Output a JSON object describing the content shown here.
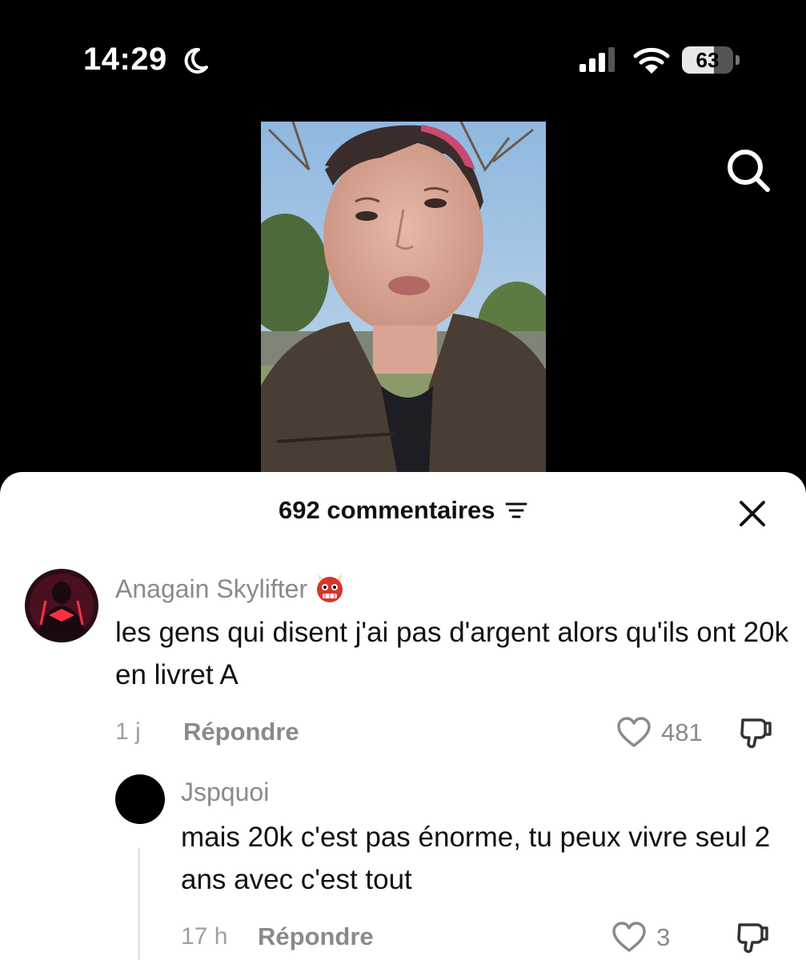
{
  "status_bar": {
    "time": "14:29",
    "battery_percent": 63,
    "battery_label": "63",
    "icons": [
      "moon-icon",
      "cellular-signal-icon",
      "wifi-icon",
      "battery-icon"
    ]
  },
  "video": {
    "thumbnail": "video-thumbnail",
    "search_icon": "search-icon"
  },
  "comments_panel": {
    "count_label": "692 commentaires",
    "sort_icon": "sort-icon",
    "close_icon": "close-icon",
    "comments": [
      {
        "username": "Anagain Skylifter",
        "badge_icon": "ogre-mask-emoji-icon",
        "text": "les gens qui disent j'ai pas d'argent alors qu'ils ont 20k en livret A",
        "time": "1 j",
        "reply_label": "Répondre",
        "like_count": "481"
      },
      {
        "username": "Jspquoi",
        "text": "mais 20k c'est pas énorme, tu peux vivre seul 2 ans avec c'est tout",
        "time": "17 h",
        "reply_label": "Répondre",
        "like_count": "3"
      }
    ]
  },
  "colors": {
    "background_top": "#000000",
    "sheet_background": "#ffffff",
    "muted_text": "#8a8a8a",
    "primary_text": "#111111"
  }
}
